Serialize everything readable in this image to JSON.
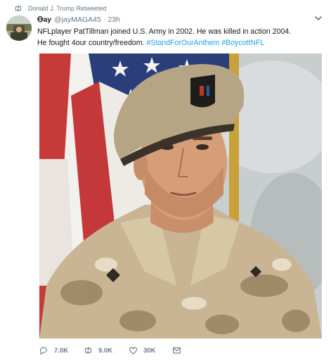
{
  "retweet": {
    "label": "Donald J. Trump Retweeted",
    "icon": "retweet-icon"
  },
  "tweet": {
    "display_name": "Ꝋay",
    "handle": "@jayMAGA45",
    "separator": "·",
    "time": "23h",
    "text_line1": "NFLplayer PatTillman joined U.S. Army in 2002. He was killed in action 2004.",
    "text_line2_plain": "He fought 4our country/freedom.",
    "hashtag1": "#StandForOurAnthem",
    "hashtag2": "#BoycottNFL"
  },
  "actions": {
    "reply_count": "7.0K",
    "retweet_count": "9.0K",
    "like_count": "30K"
  },
  "icons": [
    "retweet-icon",
    "chevron-down-icon",
    "reply-icon",
    "heart-icon",
    "mail-icon"
  ],
  "colors": {
    "link": "#1da1f2",
    "muted": "#657786",
    "text": "#14171a"
  }
}
